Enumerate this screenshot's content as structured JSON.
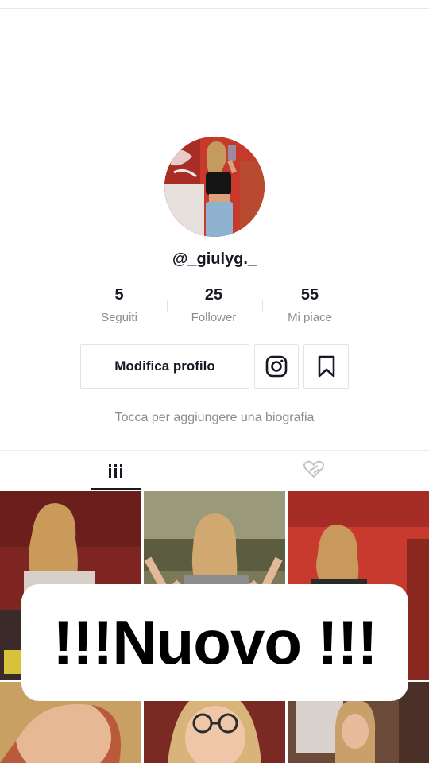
{
  "profile": {
    "username": "@_giulyg._",
    "bio_placeholder": "Tocca per aggiungere una biografia"
  },
  "stats": [
    {
      "value": "5",
      "label": "Seguiti"
    },
    {
      "value": "25",
      "label": "Follower"
    },
    {
      "value": "55",
      "label": "Mi piace"
    }
  ],
  "actions": {
    "edit_profile_label": "Modifica profilo",
    "instagram_icon": "instagram-icon",
    "bookmark_icon": "bookmark-icon"
  },
  "tabs": [
    {
      "icon": "grid-icon",
      "active": true
    },
    {
      "icon": "liked-heart-icon",
      "active": false
    }
  ],
  "videos": [
    {
      "thumbnail": "red-room-girl",
      "color": "#8e2a25"
    },
    {
      "thumbnail": "green-room-girl",
      "color": "#8a8a6a"
    },
    {
      "thumbnail": "red-wall-girl",
      "color": "#c23a2e"
    },
    {
      "thumbnail": "closeup-girl",
      "color": "#b85a3c"
    },
    {
      "thumbnail": "glasses-girl",
      "color": "#7a2a22"
    },
    {
      "thumbnail": "window-girl",
      "color": "#6b4a3a"
    }
  ],
  "overlay_text": "!!!Nuovo !!!"
}
